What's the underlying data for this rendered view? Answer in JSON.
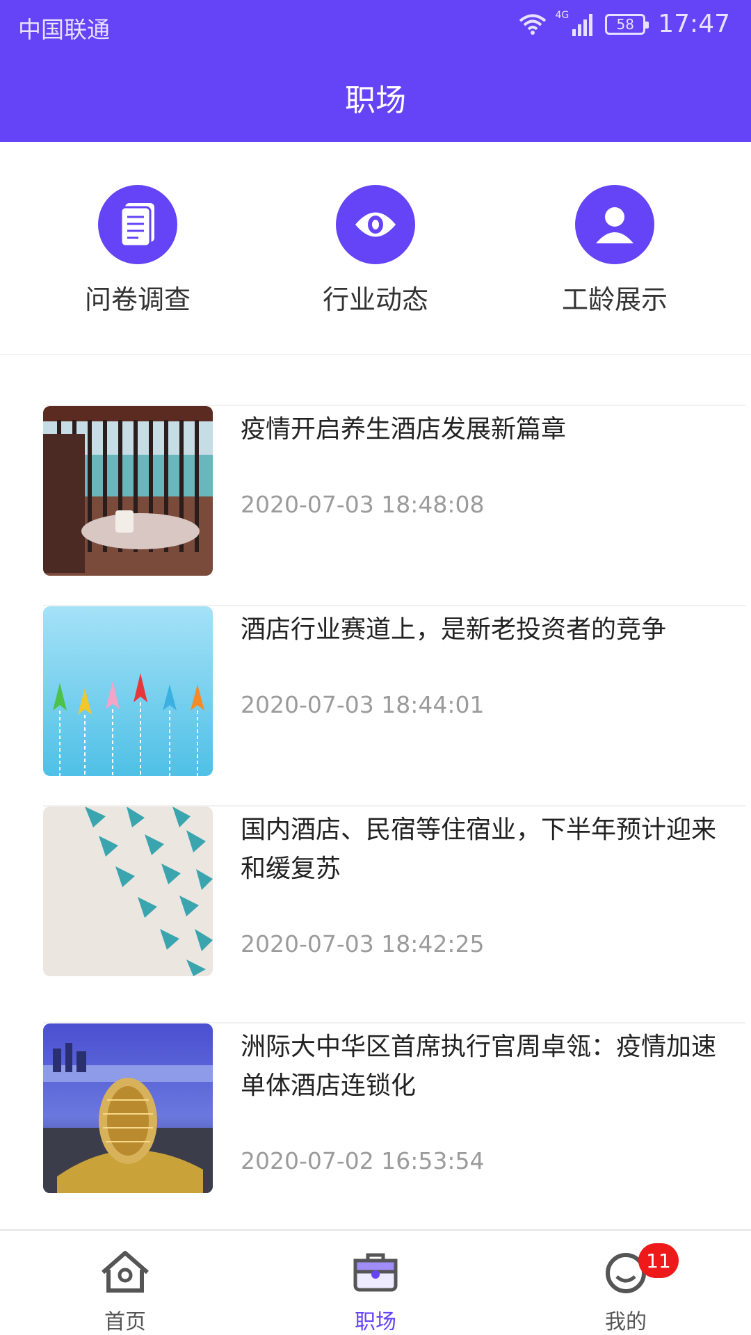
{
  "status_bar": {
    "carrier": "中国联通",
    "network": "4G",
    "battery": "58",
    "time": "17:47",
    "icons": [
      "wifi-icon",
      "signal-icon",
      "battery-icon"
    ]
  },
  "header": {
    "title": "职场"
  },
  "shortcuts": [
    {
      "label": "问卷调查",
      "icon": "document-icon"
    },
    {
      "label": "行业动态",
      "icon": "eye-icon"
    },
    {
      "label": "工龄展示",
      "icon": "person-icon"
    }
  ],
  "articles": [
    {
      "title": "疫情开启养生酒店发展新篇章",
      "date": "2020-07-03 18:48:08",
      "thumb": "balcony-sea-photo"
    },
    {
      "title": "酒店行业赛道上，是新老投资者的竞争",
      "date": "2020-07-03 18:44:01",
      "thumb": "paper-planes-blue-photo"
    },
    {
      "title": "国内酒店、民宿等住宿业，下半年预计迎来和缓复苏",
      "date": "2020-07-03 18:42:25",
      "thumb": "paper-planes-teal-photo"
    },
    {
      "title": "洲际大中华区首席执行官周卓瓴：疫情加速单体酒店连锁化",
      "date": "2020-07-02 16:53:54",
      "thumb": "hotel-night-photo"
    }
  ],
  "tabbar": {
    "tabs": [
      {
        "label": "首页",
        "icon": "home-icon"
      },
      {
        "label": "职场",
        "icon": "briefcase-icon"
      },
      {
        "label": "我的",
        "icon": "profile-icon"
      }
    ],
    "active": "职场",
    "badge": "11"
  },
  "colors": {
    "accent": "#6444f6",
    "badge": "#ee1a1a",
    "date": "#9b9b9b"
  }
}
